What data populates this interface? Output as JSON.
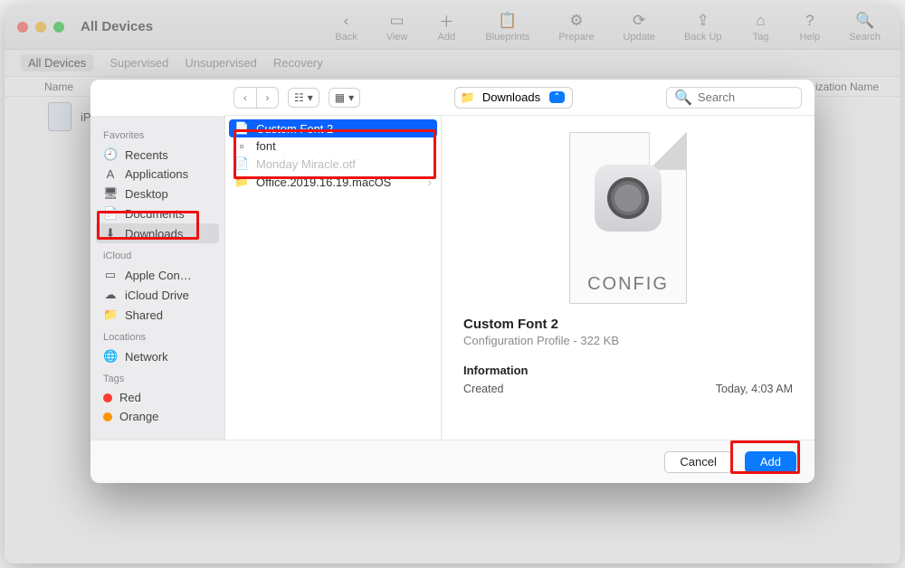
{
  "window": {
    "title": "All Devices",
    "toolbar": [
      {
        "icon": "‹",
        "label": "Back"
      },
      {
        "icon": "▭",
        "label": "View"
      },
      {
        "icon": "＋",
        "label": "Add"
      },
      {
        "icon": "📋",
        "label": "Blueprints"
      },
      {
        "icon": "⚙",
        "label": "Prepare"
      },
      {
        "icon": "⟳",
        "label": "Update"
      },
      {
        "icon": "⇪",
        "label": "Back Up"
      },
      {
        "icon": "⌂",
        "label": "Tag"
      },
      {
        "icon": "?",
        "label": "Help"
      },
      {
        "icon": "🔍",
        "label": "Search"
      }
    ],
    "filters": {
      "items": [
        "All Devices",
        "Supervised",
        "Unsupervised",
        "Recovery"
      ],
      "active": "All Devices"
    },
    "columns": {
      "first": "Name",
      "last": "…nization Name"
    },
    "device_row": {
      "name": "iPa…"
    }
  },
  "sheet": {
    "sidebar": {
      "favorites_hdr": "Favorites",
      "favorites": [
        {
          "icon": "🕘",
          "label": "Recents"
        },
        {
          "icon": "A",
          "label": "Applications"
        },
        {
          "icon": "🖥",
          "label": "Desktop"
        },
        {
          "icon": "📄",
          "label": "Documents"
        },
        {
          "icon": "⬇",
          "label": "Downloads",
          "selected": true
        }
      ],
      "icloud_hdr": "iCloud",
      "icloud": [
        {
          "icon": "▭",
          "label": "Apple Con…"
        },
        {
          "icon": "☁",
          "label": "iCloud Drive"
        },
        {
          "icon": "📁",
          "label": "Shared"
        }
      ],
      "locations_hdr": "Locations",
      "locations": [
        {
          "icon": "🌐",
          "label": "Network"
        }
      ],
      "tags_hdr": "Tags",
      "tags": [
        {
          "color": "#ff3b30",
          "label": "Red"
        },
        {
          "color": "#ff9500",
          "label": "Orange"
        }
      ]
    },
    "path_popup": {
      "folder": "Downloads"
    },
    "search": {
      "placeholder": "Search"
    },
    "files": [
      {
        "icon": "📄",
        "label": "Custom Font 2",
        "selected": true
      },
      {
        "icon": "▫",
        "label": "font"
      },
      {
        "icon": "📄",
        "label": "Monday Miracle.otf"
      },
      {
        "icon": "📁",
        "label": "Office.2019.16.19.macOS",
        "folder": true
      }
    ],
    "preview": {
      "badge": "CONFIG",
      "name": "Custom Font 2",
      "kind": "Configuration Profile - 322 KB",
      "info_hdr": "Information",
      "created_lbl": "Created",
      "created_val": "Today, 4:03 AM"
    },
    "footer": {
      "cancel": "Cancel",
      "add": "Add"
    }
  }
}
